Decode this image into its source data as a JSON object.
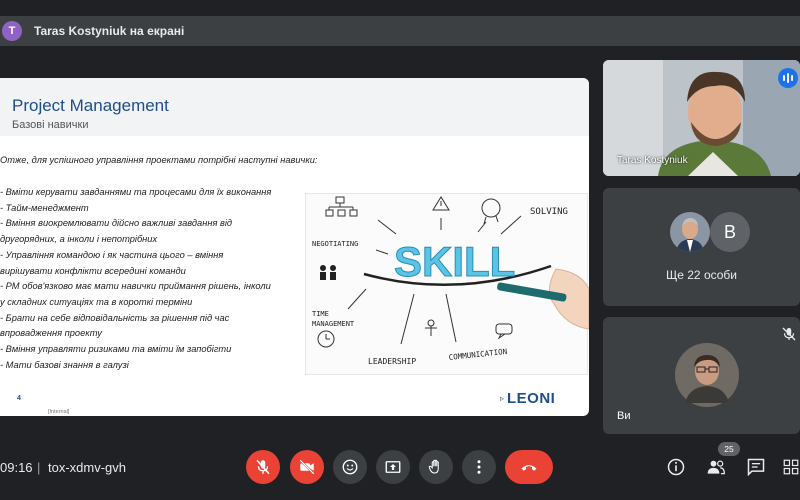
{
  "banner": {
    "avatar_letter": "T",
    "text": "Taras Kostyniuk на екрані"
  },
  "slide": {
    "title": "Project Management",
    "subtitle": "Базові навички",
    "intro": "Отже, для успішного управління проектами потрібні наступні навички:",
    "bullets": [
      "- Вміти керувати завданнями та процесами для їх виконання",
      "- Тайм-менеджмент",
      "- Вміння виокремлювати дійсно важливі завдання від",
      "  другорядних, а інколи і непотрібних",
      "- Управління командою і як частина цього – вміння",
      "  вирішувати конфлікти всередині команди",
      "- РМ обов'язково має мати навички приймання рішень, інколи",
      "  у складних ситуаціях та в короткі терміни",
      "- Брати на себе відповідальність за рішення під час",
      "  впровадження проекту",
      "- Вміння управляти ризиками та вміти їм запобігти",
      "- Мати базові знання в галузі"
    ],
    "image_words": {
      "skill": "SKILL",
      "solving": "SOLVING",
      "negotiating": "NEGOTIATING",
      "time": "TIME",
      "management": "MANAGEMENT",
      "leadership": "LEADERSHIP",
      "communication": "COMMUNICATION"
    },
    "page_number": "4",
    "classification": "[Internal]",
    "logo": "LEONI"
  },
  "participants": {
    "presenter_name": "Taras Kostyniuk",
    "others_label": "Ще 22 особи",
    "others_avatar_letter": "B",
    "self_label": "Ви"
  },
  "bottom_bar": {
    "time": "09:16",
    "separator": "|",
    "meeting_code": "tox-xdmv-gvh",
    "participant_count": "25"
  },
  "colors": {
    "accent_red": "#ea4335",
    "brand_blue": "#1f4e8c",
    "speaking_blue": "#1a73e8"
  }
}
